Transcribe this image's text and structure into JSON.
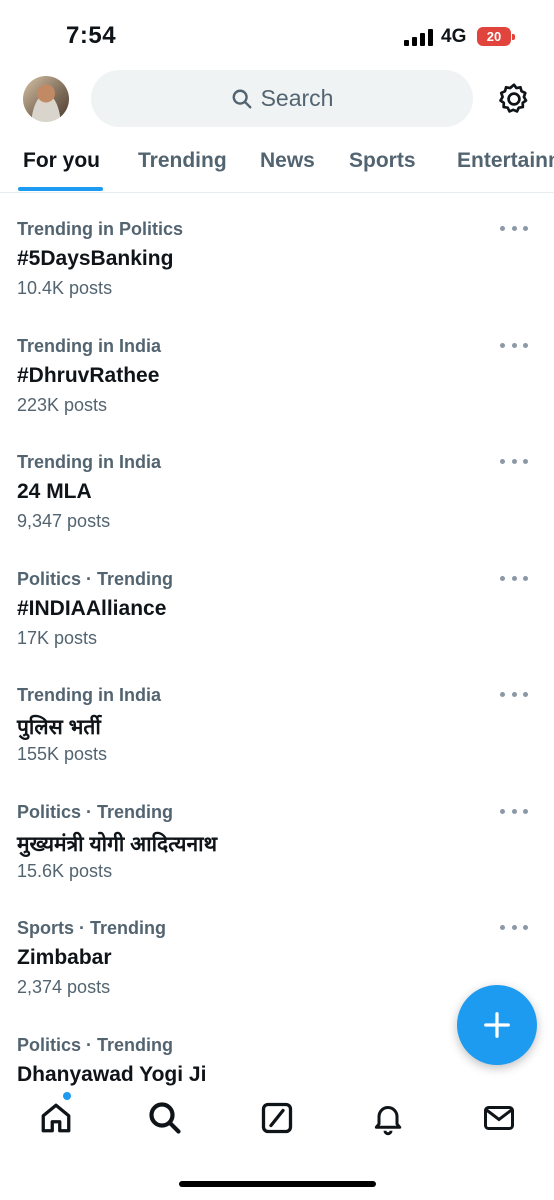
{
  "status_bar": {
    "time": "7:54",
    "network": "4G",
    "battery": "20"
  },
  "header": {
    "search_label": "Search"
  },
  "tabs": [
    {
      "label": "For you",
      "active": true
    },
    {
      "label": "Trending"
    },
    {
      "label": "News"
    },
    {
      "label": "Sports"
    },
    {
      "label": "Entertainment"
    }
  ],
  "trends": [
    {
      "context": "Trending in Politics",
      "name": "#5DaysBanking",
      "count": "10.4K posts"
    },
    {
      "context": "Trending in India",
      "name": "#DhruvRathee",
      "count": "223K posts"
    },
    {
      "context": "Trending in India",
      "name": "24 MLA",
      "count": "9,347 posts"
    },
    {
      "context": "Politics · Trending",
      "name": "#INDIAAlliance",
      "count": "17K posts"
    },
    {
      "context": "Trending in India",
      "name": "पुलिस भर्ती",
      "count": "155K posts"
    },
    {
      "context": "Politics · Trending",
      "name": "मुख्यमंत्री योगी आदित्यनाथ",
      "count": "15.6K posts"
    },
    {
      "context": "Sports · Trending",
      "name": "Zimbabar",
      "count": "2,374 posts"
    },
    {
      "context": "Politics · Trending",
      "name": "Dhanyawad Yogi Ji",
      "count": ""
    }
  ],
  "colors": {
    "accent": "#1d9bf0",
    "text_secondary": "#536471",
    "battery_low": "#e0443c"
  }
}
